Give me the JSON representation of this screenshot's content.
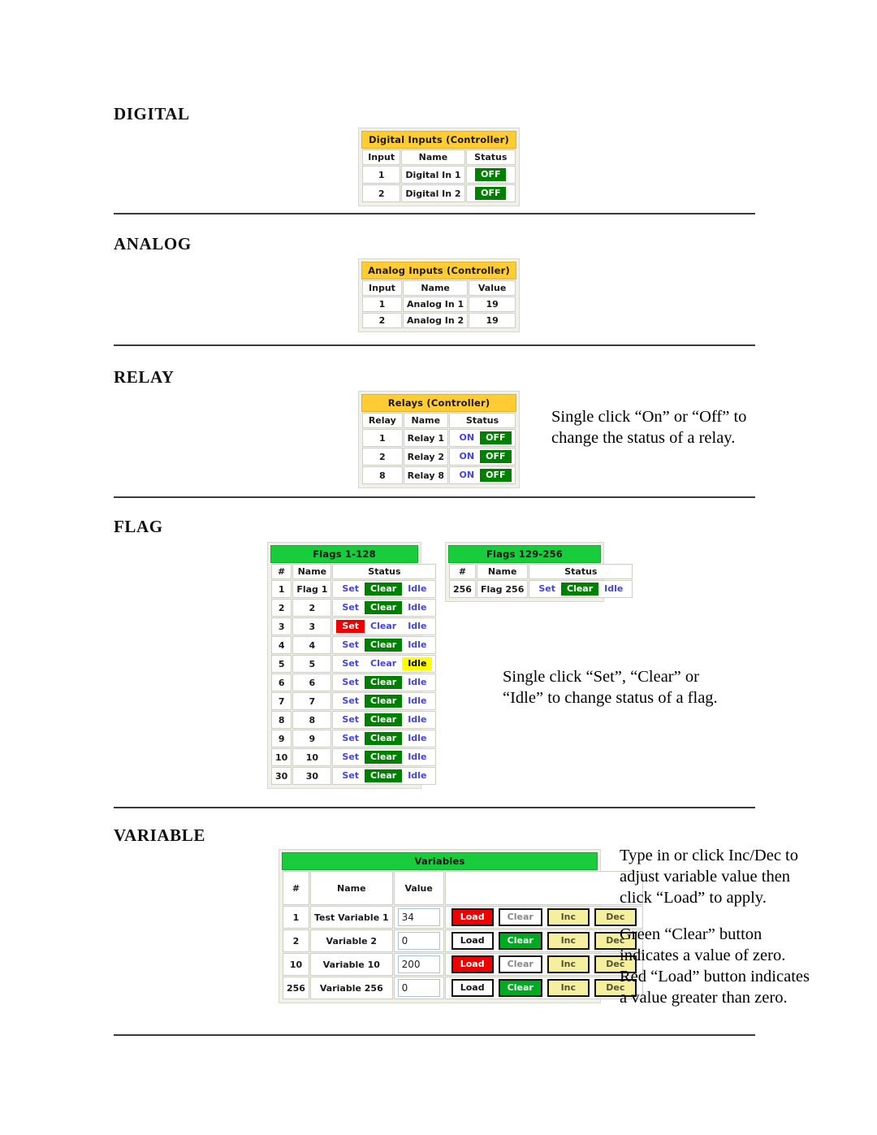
{
  "sections": {
    "digital": {
      "heading": "DIGITAL",
      "table": {
        "title": "Digital Inputs (Controller)",
        "columns": [
          "Input",
          "Name",
          "Status"
        ],
        "rows": [
          {
            "num": "1",
            "name": "Digital In 1",
            "status": "OFF"
          },
          {
            "num": "2",
            "name": "Digital In 2",
            "status": "OFF"
          }
        ]
      }
    },
    "analog": {
      "heading": "ANALOG",
      "table": {
        "title": "Analog Inputs (Controller)",
        "columns": [
          "Input",
          "Name",
          "Value"
        ],
        "rows": [
          {
            "num": "1",
            "name": "Analog In 1",
            "value": "19"
          },
          {
            "num": "2",
            "name": "Analog In 2",
            "value": "19"
          }
        ]
      }
    },
    "relay": {
      "heading": "RELAY",
      "note": [
        "Single click “On” or “Off” to",
        "change the status of a relay."
      ],
      "table": {
        "title": "Relays (Controller)",
        "columns": [
          "Relay",
          "Name",
          "Status"
        ],
        "on_label": "ON",
        "off_label": "OFF",
        "rows": [
          {
            "num": "1",
            "name": "Relay 1",
            "active": "OFF"
          },
          {
            "num": "2",
            "name": "Relay 2",
            "active": "OFF"
          },
          {
            "num": "8",
            "name": "Relay 8",
            "active": "OFF"
          }
        ]
      }
    },
    "flag": {
      "heading": "FLAG",
      "note": [
        "Single click “Set”, “Clear” or",
        "“Idle” to change status of a flag."
      ],
      "table_left": {
        "title": "Flags 1-128",
        "columns": [
          "#",
          "Name",
          "Status"
        ],
        "set_label": "Set",
        "clear_label": "Clear",
        "idle_label": "Idle",
        "rows": [
          {
            "num": "1",
            "name": "Flag 1",
            "active": "Clear"
          },
          {
            "num": "2",
            "name": "2",
            "active": "Clear"
          },
          {
            "num": "3",
            "name": "3",
            "active": "Set"
          },
          {
            "num": "4",
            "name": "4",
            "active": "Clear"
          },
          {
            "num": "5",
            "name": "5",
            "active": "Idle"
          },
          {
            "num": "6",
            "name": "6",
            "active": "Clear"
          },
          {
            "num": "7",
            "name": "7",
            "active": "Clear"
          },
          {
            "num": "8",
            "name": "8",
            "active": "Clear"
          },
          {
            "num": "9",
            "name": "9",
            "active": "Clear"
          },
          {
            "num": "10",
            "name": "10",
            "active": "Clear"
          },
          {
            "num": "30",
            "name": "30",
            "active": "Clear"
          }
        ]
      },
      "table_right": {
        "title": "Flags 129-256",
        "columns": [
          "#",
          "Name",
          "Status"
        ],
        "set_label": "Set",
        "clear_label": "Clear",
        "idle_label": "Idle",
        "rows": [
          {
            "num": "256",
            "name": "Flag 256",
            "active": "Clear"
          }
        ]
      }
    },
    "variable": {
      "heading": "VARIABLE",
      "note_a": [
        "Type in or click Inc/Dec to",
        "adjust variable value then",
        "click “Load” to apply."
      ],
      "note_b": [
        " Green “Clear” button",
        "indicates a value of zero.",
        "Red “Load” button indicates",
        "a value greater than zero."
      ],
      "table": {
        "title": "Variables",
        "columns": [
          "#",
          "Name",
          "Value",
          ""
        ],
        "load_label": "Load",
        "clear_label": "Clear",
        "inc_label": "Inc",
        "dec_label": "Dec",
        "rows": [
          {
            "num": "1",
            "name": "Test Variable 1",
            "value": "34",
            "load_state": "red",
            "clear_state": "plain"
          },
          {
            "num": "2",
            "name": "Variable 2",
            "value": "0",
            "load_state": "dark",
            "clear_state": "green"
          },
          {
            "num": "10",
            "name": "Variable 10",
            "value": "200",
            "load_state": "red",
            "clear_state": "plain"
          },
          {
            "num": "256",
            "name": "Variable 256",
            "value": "0",
            "load_state": "dark",
            "clear_state": "green"
          }
        ]
      }
    }
  },
  "colors": {
    "gold_header": "#ffcc33",
    "green_header": "#18cc3c",
    "status_green": "#008000",
    "status_red": "#ee0000",
    "status_yellow": "#ffff00",
    "link_blue": "#4444dd"
  }
}
